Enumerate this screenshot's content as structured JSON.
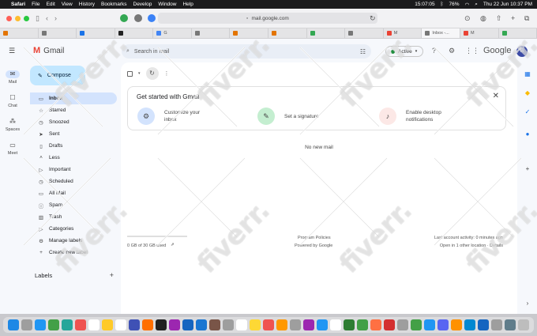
{
  "menubar": {
    "app": "Safari",
    "items": [
      "File",
      "Edit",
      "View",
      "History",
      "Bookmarks",
      "Develop",
      "Window",
      "Help"
    ],
    "timer": "15:07:05",
    "battery": "76%",
    "datetime": "Thu 22 Jun  10:37 PM"
  },
  "browser": {
    "address": "mail.google.com",
    "tabs": [
      {
        "label": "",
        "color": "#e37400"
      },
      {
        "label": "",
        "color": "#777777"
      },
      {
        "label": "",
        "color": "#1a73e8"
      },
      {
        "label": "",
        "color": "#222222"
      },
      {
        "label": "G",
        "color": "#4285f4"
      },
      {
        "label": "",
        "color": "#777777"
      },
      {
        "label": "",
        "color": "#e37400"
      },
      {
        "label": "",
        "color": "#e37400"
      },
      {
        "label": "",
        "color": "#34a853"
      },
      {
        "label": "",
        "color": "#777777"
      },
      {
        "label": "M",
        "color": "#ea4335"
      },
      {
        "label": "Inbox -...",
        "color": "#777777"
      },
      {
        "label": "M",
        "color": "#ea4335"
      },
      {
        "label": "",
        "color": "#34a853"
      }
    ]
  },
  "gmail": {
    "logo_text": "Gmail",
    "search_placeholder": "Search in mail",
    "status": "Active",
    "google_text": "Google",
    "avatar_letter": "B",
    "rail": [
      {
        "label": "Mail",
        "icon": "mail-icon",
        "glyph": "✉"
      },
      {
        "label": "Chat",
        "icon": "chat-icon",
        "glyph": "☐"
      },
      {
        "label": "Spaces",
        "icon": "spaces-icon",
        "glyph": "⁂"
      },
      {
        "label": "Meet",
        "icon": "meet-icon",
        "glyph": "▭"
      }
    ],
    "compose": "Compose",
    "nav": [
      {
        "label": "Inbox",
        "icon": "inbox-icon",
        "glyph": "▭"
      },
      {
        "label": "Starred",
        "icon": "star-icon",
        "glyph": "☆"
      },
      {
        "label": "Snoozed",
        "icon": "clock-icon",
        "glyph": "◷"
      },
      {
        "label": "Sent",
        "icon": "send-icon",
        "glyph": "➤"
      },
      {
        "label": "Drafts",
        "icon": "draft-icon",
        "glyph": "▯"
      },
      {
        "label": "Less",
        "icon": "chevron-up-icon",
        "glyph": "˄"
      },
      {
        "label": "Important",
        "icon": "important-icon",
        "glyph": "▷"
      },
      {
        "label": "Scheduled",
        "icon": "schedule-icon",
        "glyph": "◷"
      },
      {
        "label": "All Mail",
        "icon": "all-mail-icon",
        "glyph": "▭"
      },
      {
        "label": "Spam",
        "icon": "spam-icon",
        "glyph": "ⓘ"
      },
      {
        "label": "Trash",
        "icon": "trash-icon",
        "glyph": "▥"
      },
      {
        "label": "Categories",
        "icon": "label-icon",
        "glyph": "▷"
      },
      {
        "label": "Manage labels",
        "icon": "gear-icon",
        "glyph": "⚙"
      },
      {
        "label": "Create new label",
        "icon": "plus-icon",
        "glyph": "+"
      }
    ],
    "labels_heading": "Labels",
    "setup": {
      "title": "Get started with Gmail",
      "options": [
        {
          "line1": "Customize your",
          "line2": "inbox",
          "icon": "gear-icon",
          "glyph": "⚙",
          "bg": "#d3e3fd"
        },
        {
          "line1": "Set a signature",
          "line2": "",
          "icon": "pen-icon",
          "glyph": "✎",
          "bg": "#c4eed0"
        },
        {
          "line1": "Enable desktop",
          "line2": "notifications",
          "icon": "bell-icon",
          "glyph": "♪",
          "bg": "#fce8e6"
        }
      ]
    },
    "no_mail": "No new mail",
    "footer": {
      "storage": "0 GB of 30 GB used",
      "storage_fraction": 0.0,
      "program_policies": "Program Policies",
      "powered_by": "Powered by Google",
      "last_activity": "Last account activity: 0 minutes ago",
      "open_location": "Open in 1 other location · Details"
    }
  },
  "dock": {
    "icons": [
      "#1e88e5",
      "#9e9e9e",
      "#2196f3",
      "#43a047",
      "#26a69a",
      "#ef5350",
      "#ffffff",
      "#ffca28",
      "#ffffff",
      "#3f51b5",
      "#ff6f00",
      "#212121",
      "#9c27b0",
      "#1565c0",
      "#1976d2",
      "#795548",
      "#9e9e9e",
      "#ffffff",
      "#fdd835",
      "#ef5350",
      "#ff9800",
      "#9e9e9e",
      "#9c27b0",
      "#2196f3",
      "#ffffff",
      "#2e7d32",
      "#43a047",
      "#ff7043",
      "#d32f2f",
      "#9e9e9e",
      "#43a047",
      "#2196f3",
      "#5865f2",
      "#ff9100",
      "#0288d1",
      "#1565c0",
      "#9e9e9e",
      "#607d8b",
      "#bdbdbd"
    ]
  },
  "watermark": "fiverr."
}
